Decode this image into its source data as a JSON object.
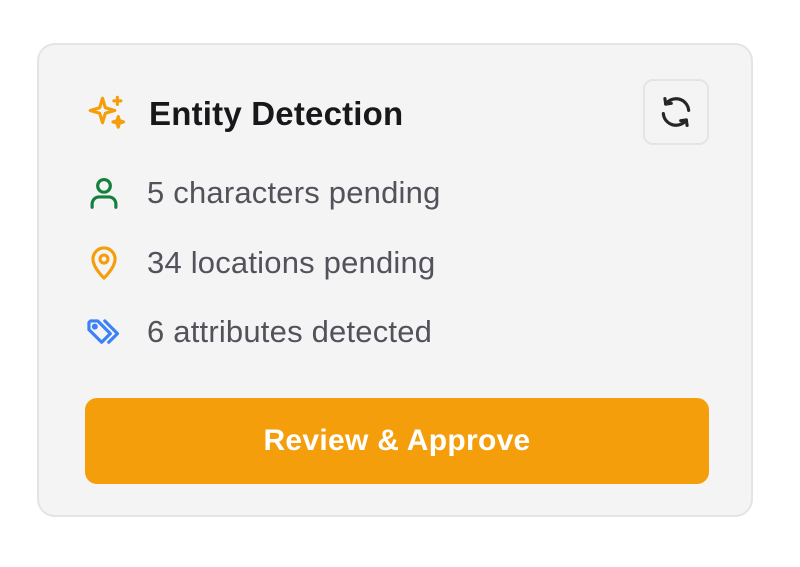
{
  "card": {
    "title": "Entity Detection",
    "stats": [
      {
        "icon": "user-icon",
        "label": "5 characters pending",
        "color": "#15803d"
      },
      {
        "icon": "map-pin-icon",
        "label": "34 locations pending",
        "color": "#f59e0b"
      },
      {
        "icon": "tags-icon",
        "label": "6 attributes detected",
        "color": "#3b82f6"
      }
    ],
    "refresh_icon": "refresh-icon",
    "header_icon": "sparkles-icon",
    "action_label": "Review & Approve"
  },
  "colors": {
    "accent": "#f59e0b",
    "card_background": "#f4f4f5",
    "title_text": "#18181b",
    "body_text": "#52525b"
  }
}
